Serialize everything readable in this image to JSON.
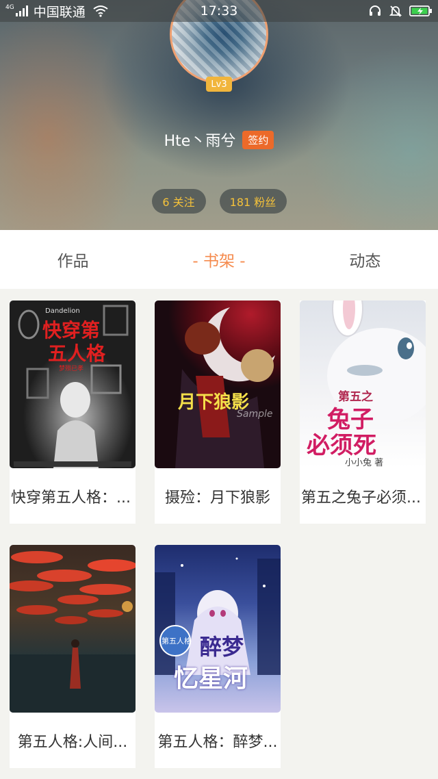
{
  "status_bar": {
    "network_tag": "4G",
    "carrier": "中国联通",
    "time": "17:33"
  },
  "profile": {
    "level": "Lv3",
    "username": "Hte丶雨兮",
    "signed_tag": "签约",
    "following": "6 关注",
    "fans": "181 粉丝"
  },
  "tabs": [
    {
      "label": "作品",
      "active": false
    },
    {
      "label": "- 书架 -",
      "active": true
    },
    {
      "label": "动态",
      "active": false
    }
  ],
  "books": [
    {
      "title": "快穿第五人格：...",
      "cover_text_1": "快穿第",
      "cover_text_2": "五人格",
      "cover_small": "Dandelion",
      "cover_author": "梦殒已孝"
    },
    {
      "title": "摄殓：月下狼影",
      "cover_text_1": "月下狼影",
      "cover_small": "Sample"
    },
    {
      "title": "第五之兔子必须...",
      "cover_text_1": "第五之",
      "cover_text_2": "兔子",
      "cover_text_3": "必须死",
      "cover_author": "小小兔 著"
    },
    {
      "title": "第五人格:人间...",
      "cover_text_1": ""
    },
    {
      "title": "第五人格：醉梦...",
      "cover_text_1": "醉梦",
      "cover_text_2": "忆星河",
      "cover_small": "第五人格"
    }
  ]
}
